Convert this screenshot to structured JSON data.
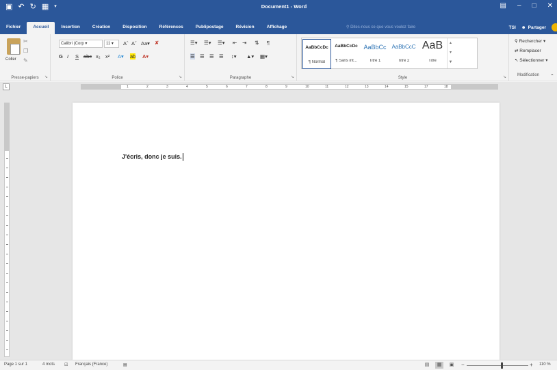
{
  "app": {
    "title": "Document1 - Word",
    "accent": "#2b579a"
  },
  "qat": {
    "save_icon": "save-icon",
    "undo_icon": "undo-icon",
    "redo_icon": "redo-icon",
    "folder_icon": "folder-icon"
  },
  "tabs": [
    {
      "label": "Fichier"
    },
    {
      "label": "Accueil",
      "active": true
    },
    {
      "label": "Insertion"
    },
    {
      "label": "Création"
    },
    {
      "label": "Disposition"
    },
    {
      "label": "Références"
    },
    {
      "label": "Publipostage"
    },
    {
      "label": "Révision"
    },
    {
      "label": "Affichage"
    }
  ],
  "tellme": {
    "placeholder": "Dites-nous ce que vous voulez faire"
  },
  "account": {
    "user": "TSI",
    "share_label": "Partager"
  },
  "ribbon": {
    "clipboard": {
      "paste_label": "Coller",
      "group_label": "Presse-papiers"
    },
    "font": {
      "font_name": "Calibri (Corp",
      "font_size": "11",
      "group_label": "Police",
      "bold": "G",
      "italic": "I",
      "underline": "S"
    },
    "paragraph": {
      "group_label": "Paragraphe"
    },
    "styles": {
      "group_label": "Style",
      "items": [
        {
          "preview": "AaBbCcDc",
          "name": "¶ Normal"
        },
        {
          "preview": "AaBbCcDc",
          "name": "¶ Sans int..."
        },
        {
          "preview": "AaBbCc",
          "name": "Titre 1"
        },
        {
          "preview": "AaBbCcC",
          "name": "Titre 2"
        },
        {
          "preview": "AaB",
          "name": "Titre"
        }
      ]
    },
    "editing": {
      "group_label": "Modification",
      "find": "Rechercher",
      "replace": "Remplacer",
      "select": "Sélectionner"
    }
  },
  "ruler": {
    "numbers": [
      "1",
      "2",
      "3",
      "4",
      "5",
      "6",
      "7",
      "8",
      "9",
      "10",
      "11",
      "12",
      "13",
      "14",
      "15",
      "17",
      "18"
    ]
  },
  "document": {
    "text": "J'écris, donc je suis."
  },
  "status": {
    "page": "Page 1 sur 1",
    "words": "4 mots",
    "language": "Français (France)",
    "zoom": "110 %"
  }
}
